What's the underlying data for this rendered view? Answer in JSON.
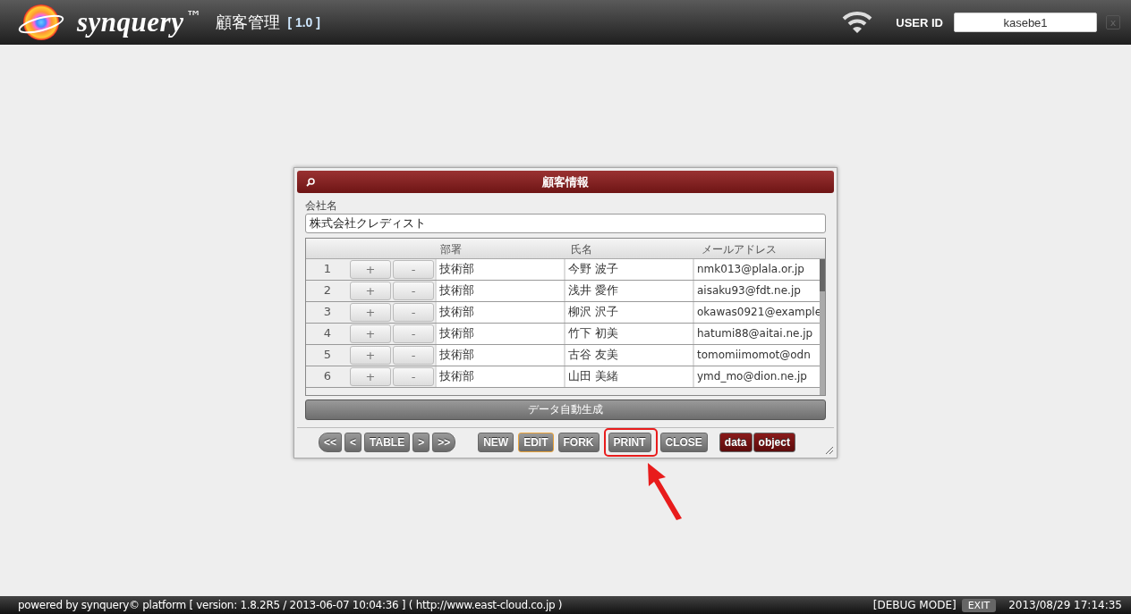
{
  "header": {
    "brand": "synquery",
    "trademark": "™",
    "app_title": "顧客管理",
    "version": "[ 1.0 ]",
    "user_id_label": "USER ID",
    "user_id": "kasebe1",
    "close_glyph": "x"
  },
  "dialog": {
    "title": "顧客情報",
    "company_label": "会社名",
    "company_value": "株式会社クレディスト",
    "columns": [
      "部署",
      "氏名",
      "メールアドレス"
    ],
    "rows": [
      {
        "no": "1",
        "plus": "+",
        "minus": "-",
        "dept": "技術部",
        "name": "今野 波子",
        "email": "nmk013@plala.or.jp"
      },
      {
        "no": "2",
        "plus": "+",
        "minus": "-",
        "dept": "技術部",
        "name": "浅井 愛作",
        "email": "aisaku93@fdt.ne.jp"
      },
      {
        "no": "3",
        "plus": "+",
        "minus": "-",
        "dept": "技術部",
        "name": "柳沢 沢子",
        "email": "okawas0921@example"
      },
      {
        "no": "4",
        "plus": "+",
        "minus": "-",
        "dept": "技術部",
        "name": "竹下 初美",
        "email": "hatumi88@aitai.ne.jp"
      },
      {
        "no": "5",
        "plus": "+",
        "minus": "-",
        "dept": "技術部",
        "name": "古谷 友美",
        "email": "tomomiimomot@odn"
      },
      {
        "no": "6",
        "plus": "+",
        "minus": "-",
        "dept": "技術部",
        "name": "山田 美緒",
        "email": "ymd_mo@dion.ne.jp"
      }
    ],
    "generate_button": "データ自動生成",
    "toolbar": [
      {
        "label": "<<",
        "kind": "nav",
        "selected": false,
        "annotated": false
      },
      {
        "label": "<",
        "kind": "nav",
        "selected": false,
        "annotated": false
      },
      {
        "label": "TABLE",
        "kind": "nav",
        "selected": false,
        "annotated": false
      },
      {
        "label": ">",
        "kind": "nav",
        "selected": false,
        "annotated": false
      },
      {
        "label": ">>",
        "kind": "nav",
        "selected": false,
        "annotated": false
      },
      {
        "label": "NEW",
        "kind": "action",
        "selected": false,
        "annotated": false
      },
      {
        "label": "EDIT",
        "kind": "action",
        "selected": true,
        "annotated": false
      },
      {
        "label": "FORK",
        "kind": "action",
        "selected": false,
        "annotated": false
      },
      {
        "label": "PRINT",
        "kind": "action",
        "selected": false,
        "annotated": true
      },
      {
        "label": "CLOSE",
        "kind": "action",
        "selected": false,
        "annotated": false
      },
      {
        "label": "data",
        "kind": "dark",
        "selected": false,
        "annotated": false
      },
      {
        "label": "object",
        "kind": "dark",
        "selected": false,
        "annotated": false
      }
    ]
  },
  "status_bar": {
    "left": "powered by synquery© platform [ version: 1.8.2R5 / 2013-06-07 10:04:36 ] ( http://www.east-cloud.co.jp )",
    "mode": "[DEBUG MODE]",
    "exit": "EXIT",
    "datetime": "2013/08/29 17:14:35"
  }
}
